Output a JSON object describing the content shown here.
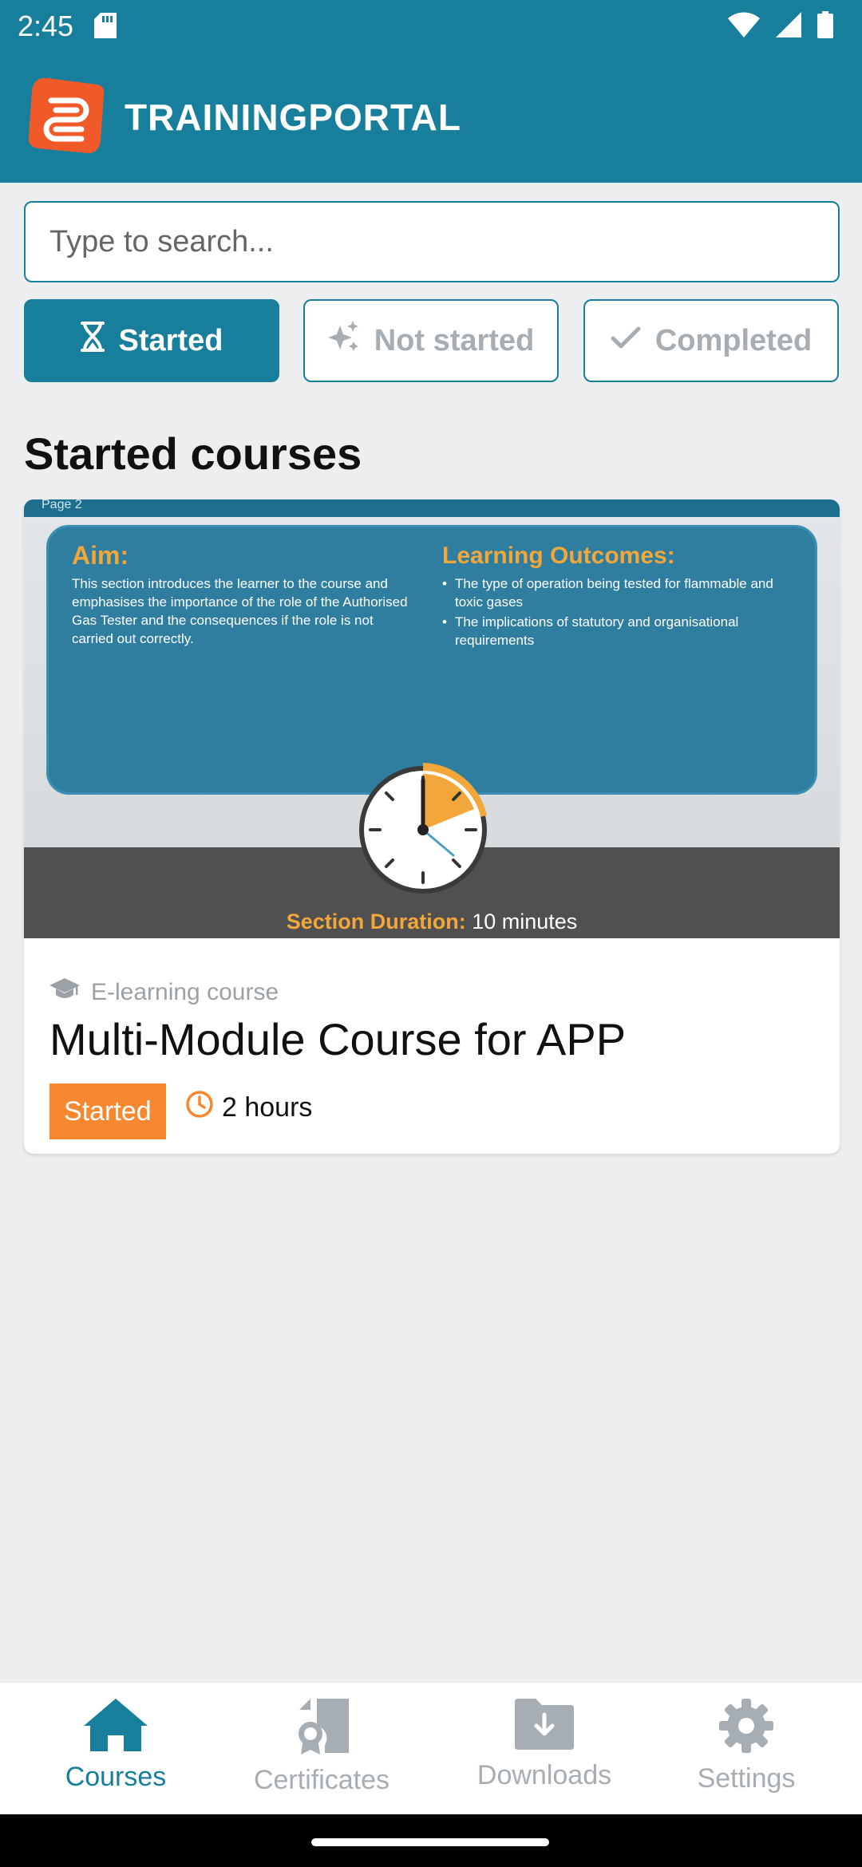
{
  "status": {
    "time": "2:45"
  },
  "header": {
    "brand": "TRAININGPORTAL"
  },
  "search": {
    "placeholder": "Type to search..."
  },
  "filters": [
    {
      "label": "Started",
      "active": true
    },
    {
      "label": "Not started",
      "active": false
    },
    {
      "label": "Completed",
      "active": false
    }
  ],
  "section": {
    "title": "Started courses"
  },
  "course": {
    "thumbnail": {
      "page_label": "Page 2",
      "aim_title": "Aim:",
      "aim_text": "This section introduces the learner to the course and emphasises the importance of the role of the Authorised Gas Tester and the consequences if the role is not carried out correctly.",
      "outcomes_title": "Learning Outcomes:",
      "outcomes": [
        "The type of operation being tested for flammable and toxic gases",
        "The implications of statutory and organisational requirements"
      ],
      "duration_label": "Section Duration:",
      "duration_value": "10 minutes"
    },
    "type": "E-learning course",
    "title": "Multi-Module Course for APP",
    "badge": "Started",
    "duration": "2 hours"
  },
  "nav": {
    "items": [
      {
        "label": "Courses",
        "active": true
      },
      {
        "label": "Certificates",
        "active": false
      },
      {
        "label": "Downloads",
        "active": false
      },
      {
        "label": "Settings",
        "active": false
      }
    ]
  },
  "colors": {
    "primary": "#177e9c",
    "accent": "#f7882f",
    "logo": "#f05a28"
  }
}
